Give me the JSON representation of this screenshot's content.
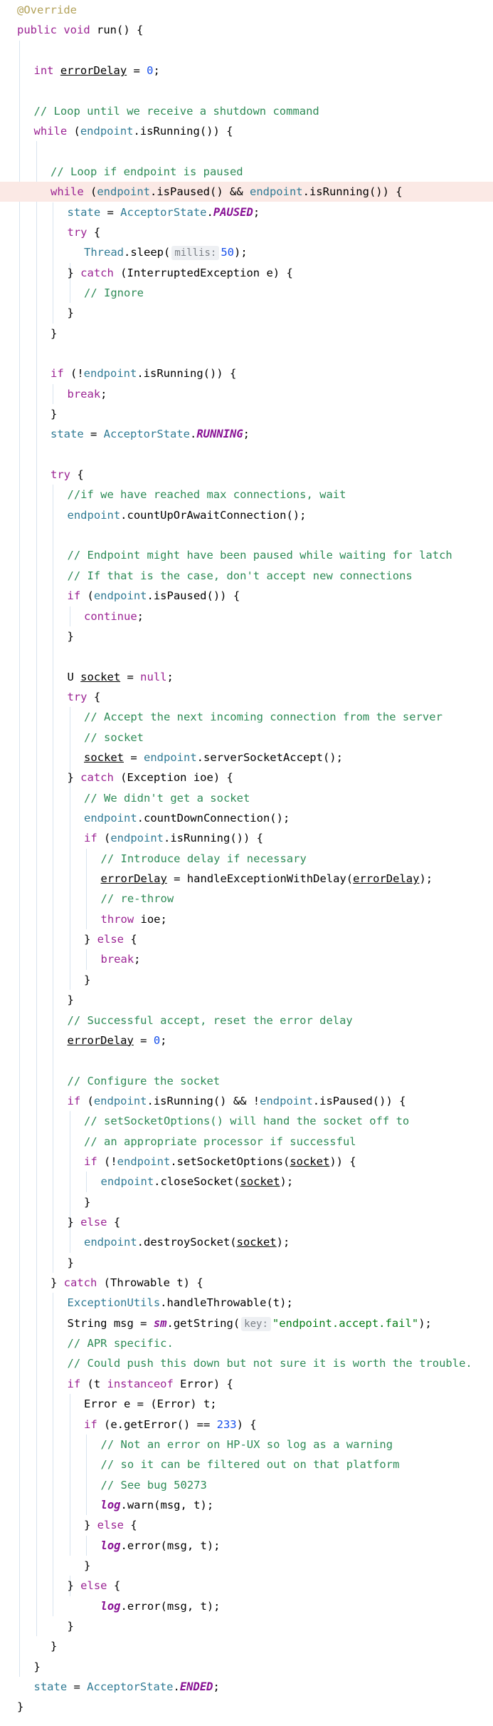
{
  "lines": [
    {
      "indent": 0,
      "tokens": [
        {
          "t": "@Override",
          "c": "an"
        }
      ]
    },
    {
      "indent": 0,
      "tokens": [
        {
          "t": "public ",
          "c": "kw"
        },
        {
          "t": "void ",
          "c": "kw"
        },
        {
          "t": "run() {"
        }
      ]
    },
    {
      "indent": 0,
      "tokens": []
    },
    {
      "indent": 1,
      "tokens": [
        {
          "t": "int ",
          "c": "kw"
        },
        {
          "t": "errorDelay",
          "c": "ul"
        },
        {
          "t": " = "
        },
        {
          "t": "0",
          "c": "num"
        },
        {
          "t": ";"
        }
      ]
    },
    {
      "indent": 0,
      "tokens": []
    },
    {
      "indent": 1,
      "tokens": [
        {
          "t": "// Loop until we receive a shutdown command",
          "c": "cm"
        }
      ]
    },
    {
      "indent": 1,
      "tokens": [
        {
          "t": "while ",
          "c": "kw"
        },
        {
          "t": "("
        },
        {
          "t": "endpoint",
          "c": "fld"
        },
        {
          "t": ".isRunning()) {"
        }
      ]
    },
    {
      "indent": 0,
      "tokens": []
    },
    {
      "indent": 2,
      "tokens": [
        {
          "t": "// Loop if endpoint is paused",
          "c": "cm"
        }
      ]
    },
    {
      "indent": 2,
      "hl": true,
      "tokens": [
        {
          "t": "while ",
          "c": "kw"
        },
        {
          "t": "("
        },
        {
          "t": "endpoint",
          "c": "fld"
        },
        {
          "t": ".isPaused() && "
        },
        {
          "t": "endpoint",
          "c": "fld"
        },
        {
          "t": ".isRunning()) {"
        }
      ]
    },
    {
      "indent": 3,
      "tokens": [
        {
          "t": "state",
          "c": "fld"
        },
        {
          "t": " = "
        },
        {
          "t": "AcceptorState",
          "c": "fld"
        },
        {
          "t": "."
        },
        {
          "t": "PAUSED",
          "c": "st"
        },
        {
          "t": ";"
        }
      ]
    },
    {
      "indent": 3,
      "tokens": [
        {
          "t": "try ",
          "c": "kw"
        },
        {
          "t": "{"
        }
      ]
    },
    {
      "indent": 4,
      "tokens": [
        {
          "t": "Thread",
          "c": "fld"
        },
        {
          "t": ".sleep("
        },
        {
          "t": "millis:",
          "c": "hint"
        },
        {
          "t": "50",
          "c": "num"
        },
        {
          "t": ");"
        }
      ]
    },
    {
      "indent": 3,
      "tokens": [
        {
          "t": "} "
        },
        {
          "t": "catch ",
          "c": "kw"
        },
        {
          "t": "(InterruptedException e) {"
        }
      ]
    },
    {
      "indent": 4,
      "tokens": [
        {
          "t": "// Ignore",
          "c": "cm"
        }
      ]
    },
    {
      "indent": 3,
      "tokens": [
        {
          "t": "}"
        }
      ]
    },
    {
      "indent": 2,
      "tokens": [
        {
          "t": "}"
        }
      ]
    },
    {
      "indent": 0,
      "tokens": []
    },
    {
      "indent": 2,
      "tokens": [
        {
          "t": "if ",
          "c": "kw"
        },
        {
          "t": "(!"
        },
        {
          "t": "endpoint",
          "c": "fld"
        },
        {
          "t": ".isRunning()) {"
        }
      ]
    },
    {
      "indent": 3,
      "tokens": [
        {
          "t": "break",
          "c": "kw"
        },
        {
          "t": ";"
        }
      ]
    },
    {
      "indent": 2,
      "tokens": [
        {
          "t": "}"
        }
      ]
    },
    {
      "indent": 2,
      "tokens": [
        {
          "t": "state",
          "c": "fld"
        },
        {
          "t": " = "
        },
        {
          "t": "AcceptorState",
          "c": "fld"
        },
        {
          "t": "."
        },
        {
          "t": "RUNNING",
          "c": "st"
        },
        {
          "t": ";"
        }
      ]
    },
    {
      "indent": 0,
      "tokens": []
    },
    {
      "indent": 2,
      "tokens": [
        {
          "t": "try ",
          "c": "kw"
        },
        {
          "t": "{"
        }
      ]
    },
    {
      "indent": 3,
      "tokens": [
        {
          "t": "//if we have reached max connections, wait",
          "c": "cm"
        }
      ]
    },
    {
      "indent": 3,
      "tokens": [
        {
          "t": "endpoint",
          "c": "fld"
        },
        {
          "t": ".countUpOrAwaitConnection();"
        }
      ]
    },
    {
      "indent": 0,
      "tokens": []
    },
    {
      "indent": 3,
      "tokens": [
        {
          "t": "// Endpoint might have been paused while waiting for latch",
          "c": "cm"
        }
      ]
    },
    {
      "indent": 3,
      "tokens": [
        {
          "t": "// If that is the case, don't accept new connections",
          "c": "cm"
        }
      ]
    },
    {
      "indent": 3,
      "tokens": [
        {
          "t": "if ",
          "c": "kw"
        },
        {
          "t": "("
        },
        {
          "t": "endpoint",
          "c": "fld"
        },
        {
          "t": ".isPaused()) {"
        }
      ]
    },
    {
      "indent": 4,
      "tokens": [
        {
          "t": "continue",
          "c": "kw"
        },
        {
          "t": ";"
        }
      ]
    },
    {
      "indent": 3,
      "tokens": [
        {
          "t": "}"
        }
      ]
    },
    {
      "indent": 0,
      "tokens": []
    },
    {
      "indent": 3,
      "tokens": [
        {
          "t": "U "
        },
        {
          "t": "socket",
          "c": "ul"
        },
        {
          "t": " = "
        },
        {
          "t": "null",
          "c": "kw"
        },
        {
          "t": ";"
        }
      ]
    },
    {
      "indent": 3,
      "tokens": [
        {
          "t": "try ",
          "c": "kw"
        },
        {
          "t": "{"
        }
      ]
    },
    {
      "indent": 4,
      "tokens": [
        {
          "t": "// Accept the next incoming connection from the server",
          "c": "cm"
        }
      ]
    },
    {
      "indent": 4,
      "tokens": [
        {
          "t": "// socket",
          "c": "cm"
        }
      ]
    },
    {
      "indent": 4,
      "tokens": [
        {
          "t": "socket",
          "c": "ul"
        },
        {
          "t": " = "
        },
        {
          "t": "endpoint",
          "c": "fld"
        },
        {
          "t": ".serverSocketAccept();"
        }
      ]
    },
    {
      "indent": 3,
      "tokens": [
        {
          "t": "} "
        },
        {
          "t": "catch ",
          "c": "kw"
        },
        {
          "t": "(Exception ioe) {"
        }
      ]
    },
    {
      "indent": 4,
      "tokens": [
        {
          "t": "// We didn't get a socket",
          "c": "cm"
        }
      ]
    },
    {
      "indent": 4,
      "tokens": [
        {
          "t": "endpoint",
          "c": "fld"
        },
        {
          "t": ".countDownConnection();"
        }
      ]
    },
    {
      "indent": 4,
      "tokens": [
        {
          "t": "if ",
          "c": "kw"
        },
        {
          "t": "("
        },
        {
          "t": "endpoint",
          "c": "fld"
        },
        {
          "t": ".isRunning()) {"
        }
      ]
    },
    {
      "indent": 5,
      "tokens": [
        {
          "t": "// Introduce delay if necessary",
          "c": "cm"
        }
      ]
    },
    {
      "indent": 5,
      "tokens": [
        {
          "t": "errorDelay",
          "c": "ul"
        },
        {
          "t": " = handleExceptionWithDelay("
        },
        {
          "t": "errorDelay",
          "c": "ul"
        },
        {
          "t": ");"
        }
      ]
    },
    {
      "indent": 5,
      "tokens": [
        {
          "t": "// re-throw",
          "c": "cm"
        }
      ]
    },
    {
      "indent": 5,
      "tokens": [
        {
          "t": "throw ",
          "c": "kw"
        },
        {
          "t": "ioe;"
        }
      ]
    },
    {
      "indent": 4,
      "tokens": [
        {
          "t": "} "
        },
        {
          "t": "else ",
          "c": "kw"
        },
        {
          "t": "{"
        }
      ]
    },
    {
      "indent": 5,
      "tokens": [
        {
          "t": "break",
          "c": "kw"
        },
        {
          "t": ";"
        }
      ]
    },
    {
      "indent": 4,
      "tokens": [
        {
          "t": "}"
        }
      ]
    },
    {
      "indent": 3,
      "tokens": [
        {
          "t": "}"
        }
      ]
    },
    {
      "indent": 3,
      "tokens": [
        {
          "t": "// Successful accept, reset the error delay",
          "c": "cm"
        }
      ]
    },
    {
      "indent": 3,
      "tokens": [
        {
          "t": "errorDelay",
          "c": "ul"
        },
        {
          "t": " = "
        },
        {
          "t": "0",
          "c": "num"
        },
        {
          "t": ";"
        }
      ]
    },
    {
      "indent": 0,
      "tokens": []
    },
    {
      "indent": 3,
      "tokens": [
        {
          "t": "// Configure the socket",
          "c": "cm"
        }
      ]
    },
    {
      "indent": 3,
      "tokens": [
        {
          "t": "if ",
          "c": "kw"
        },
        {
          "t": "("
        },
        {
          "t": "endpoint",
          "c": "fld"
        },
        {
          "t": ".isRunning() && !"
        },
        {
          "t": "endpoint",
          "c": "fld"
        },
        {
          "t": ".isPaused()) {"
        }
      ]
    },
    {
      "indent": 4,
      "tokens": [
        {
          "t": "// setSocketOptions() will hand the socket off to",
          "c": "cm"
        }
      ]
    },
    {
      "indent": 4,
      "tokens": [
        {
          "t": "// an appropriate processor if successful",
          "c": "cm"
        }
      ]
    },
    {
      "indent": 4,
      "tokens": [
        {
          "t": "if ",
          "c": "kw"
        },
        {
          "t": "(!"
        },
        {
          "t": "endpoint",
          "c": "fld"
        },
        {
          "t": ".setSocketOptions("
        },
        {
          "t": "socket",
          "c": "ul"
        },
        {
          "t": ")) {"
        }
      ]
    },
    {
      "indent": 5,
      "tokens": [
        {
          "t": "endpoint",
          "c": "fld"
        },
        {
          "t": ".closeSocket("
        },
        {
          "t": "socket",
          "c": "ul"
        },
        {
          "t": ");"
        }
      ]
    },
    {
      "indent": 4,
      "tokens": [
        {
          "t": "}"
        }
      ]
    },
    {
      "indent": 3,
      "tokens": [
        {
          "t": "} "
        },
        {
          "t": "else ",
          "c": "kw"
        },
        {
          "t": "{"
        }
      ]
    },
    {
      "indent": 4,
      "tokens": [
        {
          "t": "endpoint",
          "c": "fld"
        },
        {
          "t": ".destroySocket("
        },
        {
          "t": "socket",
          "c": "ul"
        },
        {
          "t": ");"
        }
      ]
    },
    {
      "indent": 3,
      "tokens": [
        {
          "t": "}"
        }
      ]
    },
    {
      "indent": 2,
      "tokens": [
        {
          "t": "} "
        },
        {
          "t": "catch ",
          "c": "kw"
        },
        {
          "t": "(Throwable t) {"
        }
      ]
    },
    {
      "indent": 3,
      "tokens": [
        {
          "t": "ExceptionUtils",
          "c": "fld"
        },
        {
          "t": ".handleThrowable(t);"
        }
      ]
    },
    {
      "indent": 3,
      "tokens": [
        {
          "t": "String msg = "
        },
        {
          "t": "sm",
          "c": "st"
        },
        {
          "t": ".getString("
        },
        {
          "t": "key:",
          "c": "hint"
        },
        {
          "t": "\"endpoint.accept.fail\"",
          "c": "str"
        },
        {
          "t": ");"
        }
      ]
    },
    {
      "indent": 3,
      "tokens": [
        {
          "t": "// APR specific.",
          "c": "cm"
        }
      ]
    },
    {
      "indent": 3,
      "tokens": [
        {
          "t": "// Could push this down but not sure it is worth the trouble.",
          "c": "cm"
        }
      ]
    },
    {
      "indent": 3,
      "tokens": [
        {
          "t": "if ",
          "c": "kw"
        },
        {
          "t": "(t "
        },
        {
          "t": "instanceof ",
          "c": "kw"
        },
        {
          "t": "Error) {"
        }
      ]
    },
    {
      "indent": 4,
      "tokens": [
        {
          "t": "Error e = (Error) t;"
        }
      ]
    },
    {
      "indent": 4,
      "tokens": [
        {
          "t": "if ",
          "c": "kw"
        },
        {
          "t": "(e.getError() == "
        },
        {
          "t": "233",
          "c": "num"
        },
        {
          "t": ") {"
        }
      ]
    },
    {
      "indent": 5,
      "tokens": [
        {
          "t": "// Not an error on HP-UX so log as a warning",
          "c": "cm"
        }
      ]
    },
    {
      "indent": 5,
      "tokens": [
        {
          "t": "// so it can be filtered out on that platform",
          "c": "cm"
        }
      ]
    },
    {
      "indent": 5,
      "tokens": [
        {
          "t": "// See bug 50273",
          "c": "cm"
        }
      ]
    },
    {
      "indent": 5,
      "tokens": [
        {
          "t": "log",
          "c": "st"
        },
        {
          "t": ".warn(msg, t);"
        }
      ]
    },
    {
      "indent": 4,
      "tokens": [
        {
          "t": "} "
        },
        {
          "t": "else ",
          "c": "kw"
        },
        {
          "t": "{"
        }
      ]
    },
    {
      "indent": 5,
      "tokens": [
        {
          "t": "log",
          "c": "st"
        },
        {
          "t": ".error(msg, t);"
        }
      ]
    },
    {
      "indent": 4,
      "tokens": [
        {
          "t": "}"
        }
      ]
    },
    {
      "indent": 3,
      "tokens": [
        {
          "t": "} "
        },
        {
          "t": "else ",
          "c": "kw"
        },
        {
          "t": "{"
        }
      ]
    },
    {
      "indent": 5,
      "tokens": [
        {
          "t": "log",
          "c": "st"
        },
        {
          "t": ".error(msg, t);"
        }
      ]
    },
    {
      "indent": 3,
      "tokens": [
        {
          "t": "}"
        }
      ]
    },
    {
      "indent": 2,
      "tokens": [
        {
          "t": "}"
        }
      ]
    },
    {
      "indent": 1,
      "tokens": [
        {
          "t": "}"
        }
      ]
    },
    {
      "indent": 1,
      "tokens": [
        {
          "t": "state",
          "c": "fld"
        },
        {
          "t": " = "
        },
        {
          "t": "AcceptorState",
          "c": "fld"
        },
        {
          "t": "."
        },
        {
          "t": "ENDED",
          "c": "st"
        },
        {
          "t": ";"
        }
      ]
    },
    {
      "indent": 0,
      "tokens": [
        {
          "t": "}"
        }
      ]
    }
  ],
  "guides": [
    {
      "level": 1,
      "from": 2,
      "to": 82
    },
    {
      "level": 2,
      "from": 7,
      "to": 80
    },
    {
      "level": 3,
      "from": 10,
      "to": 15
    },
    {
      "level": 4,
      "from": 13,
      "to": 14
    },
    {
      "level": 3,
      "from": 19,
      "to": 19
    },
    {
      "level": 3,
      "from": 24,
      "to": 62
    },
    {
      "level": 4,
      "from": 30,
      "to": 30
    },
    {
      "level": 4,
      "from": 35,
      "to": 48
    },
    {
      "level": 5,
      "from": 42,
      "to": 45
    },
    {
      "level": 5,
      "from": 47,
      "to": 47
    },
    {
      "level": 4,
      "from": 55,
      "to": 60
    },
    {
      "level": 5,
      "from": 58,
      "to": 58
    },
    {
      "level": 4,
      "from": 61,
      "to": 61
    },
    {
      "level": 3,
      "from": 64,
      "to": 79
    },
    {
      "level": 4,
      "from": 69,
      "to": 76
    },
    {
      "level": 5,
      "from": 71,
      "to": 74
    },
    {
      "level": 5,
      "from": 76,
      "to": 76
    },
    {
      "level": 4,
      "from": 78,
      "to": 78
    }
  ]
}
